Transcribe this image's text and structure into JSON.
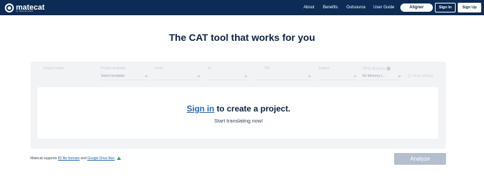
{
  "header": {
    "logo_text": "matecat",
    "logo_subtext": "by TRANSLATED",
    "nav": [
      "About",
      "Benefits",
      "Outsource",
      "User Guide"
    ],
    "aligner_label": "Aligner",
    "signin_label": "Sign In",
    "signup_label": "Sign Up"
  },
  "main": {
    "headline": "The CAT tool that works for you",
    "fields": {
      "project_name_label": "Project name",
      "project_template_label": "Project template",
      "project_template_value": "Select template",
      "from_label": "From",
      "to_label": "To",
      "tm_label": "TM",
      "subject_label": "Subject",
      "tm_glossary_label": "TM & Glossary",
      "tm_glossary_value": "No Memory L...",
      "more_label": "More settings"
    },
    "cta_link": "Sign in",
    "cta_rest": "to create a project.",
    "cta_sub": "Start translating now!",
    "footnote_prefix": "Matecat supports",
    "footnote_formats_link": "82 file formats",
    "footnote_mid": "and",
    "footnote_drive_link": "Google Drive files",
    "analyze_label": "Analyze"
  }
}
